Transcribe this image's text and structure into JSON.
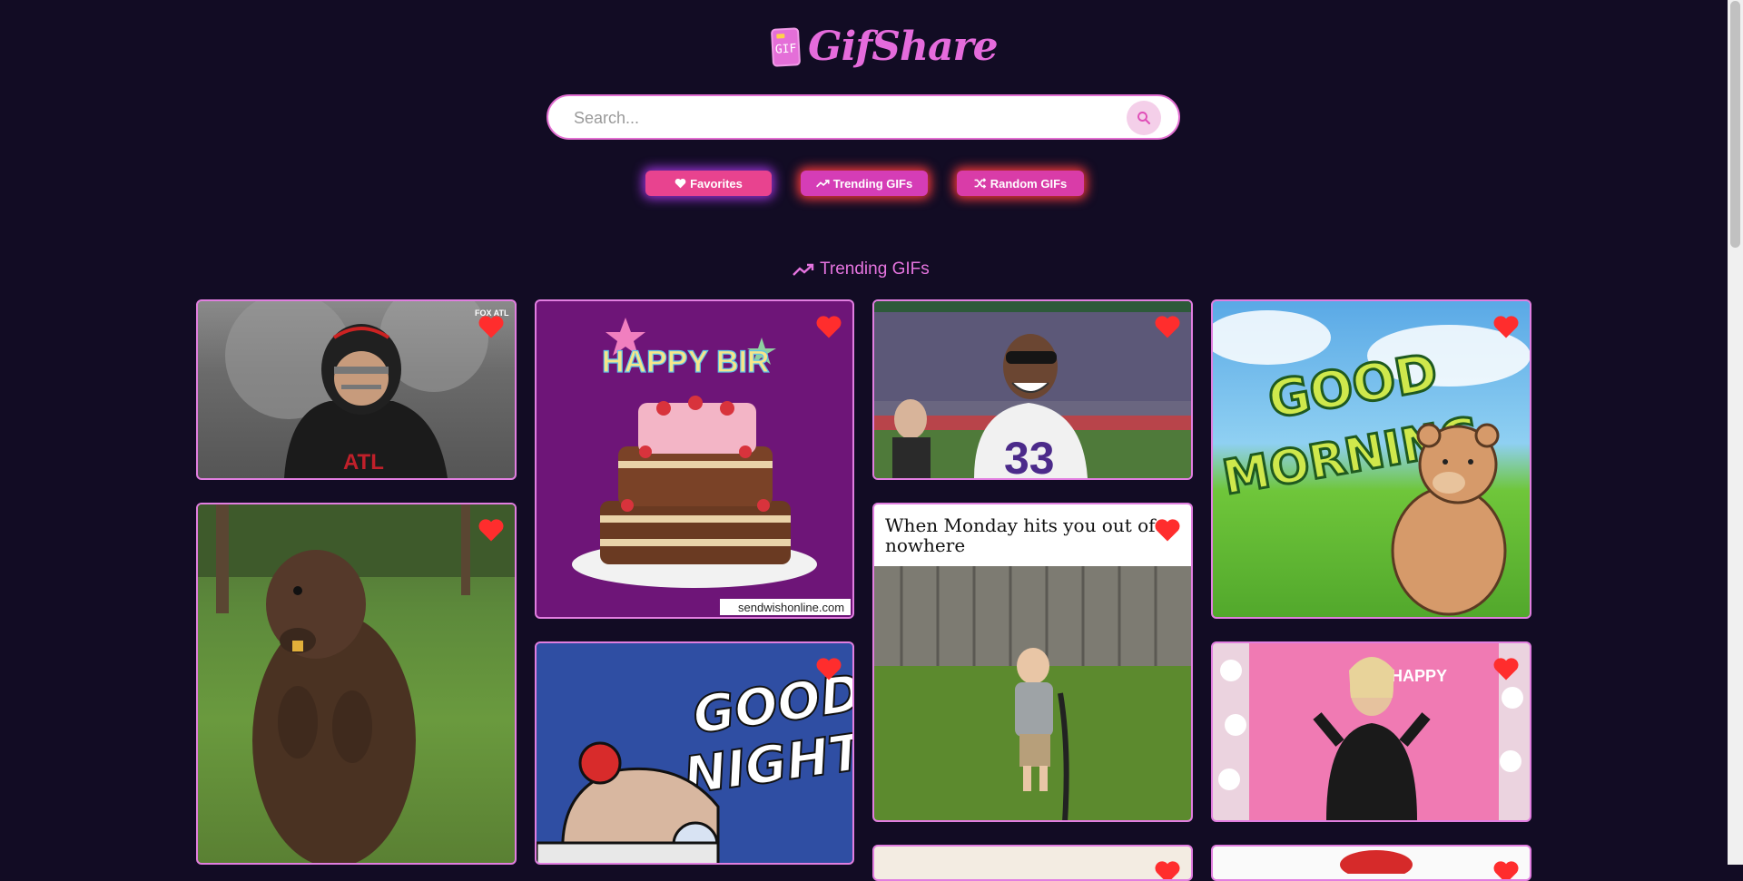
{
  "app": {
    "title": "GifShare",
    "logo_icon_text": "GIF",
    "accent_color": "#e56bdc",
    "background_color": "#120c24"
  },
  "search": {
    "placeholder": "Search...",
    "value": "",
    "icon": "search-icon"
  },
  "nav": {
    "favorites_label": "Favorites",
    "trending_label": "Trending GIFs",
    "random_label": "Random GIFs"
  },
  "section": {
    "title": "Trending GIFs",
    "icon": "trending-up-icon"
  },
  "gifs": {
    "falcons_overlay": "FOX ATL",
    "falcons_jersey": "ATL",
    "birthday_cake_text": "HAPPY BIR",
    "birthday_watermark": "sendwishonline.com",
    "vikings_jersey": "33",
    "good_morning_line1": "GOOD",
    "good_morning_line2": "MORNING",
    "monday_caption": "When Monday hits you out of nowhere",
    "good_night_line1": "GOOD",
    "good_night_line2": "NIGHT",
    "happy_text": "HAPPY"
  }
}
